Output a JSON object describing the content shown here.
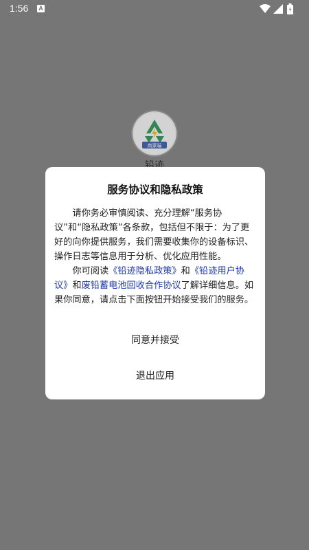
{
  "status_bar": {
    "time": "1:56",
    "notification_icon_glyph": "A",
    "icons": [
      "wifi-icon",
      "signal-icon",
      "battery-icon"
    ]
  },
  "background_app": {
    "logo_label": "商家端",
    "name": "铅迹"
  },
  "dialog": {
    "title": "服务协议和隐私政策",
    "paragraph1": "请你务必审慎阅读、充分理解“服务协议”和“隐私政策”各条款，包括但不限于：为了更好的向你提供服务，我们需要收集你的设备标识、操作日志等信息用于分析、优化应用性能。",
    "p2_prefix": "你可阅读",
    "link_privacy": "《铅迹隐私政策》",
    "p2_and": "和",
    "link_user": "《铅迹用户协议》",
    "p2_and2": "和",
    "link_coop": "废铅蓄电池回收合作协议",
    "p2_suffix": "了解详细信息。如果你同意，请点击下面按钮开始接受我们的服务。",
    "accept_label": "同意并接受",
    "exit_label": "退出应用"
  },
  "colors": {
    "scrim": "#767676",
    "dialog_bg": "#ffffff",
    "link": "#1f3aa8",
    "logo_green": "#1e8a4a",
    "logo_blue": "#2a4fa0",
    "logo_bolt": "#f1b91b"
  }
}
